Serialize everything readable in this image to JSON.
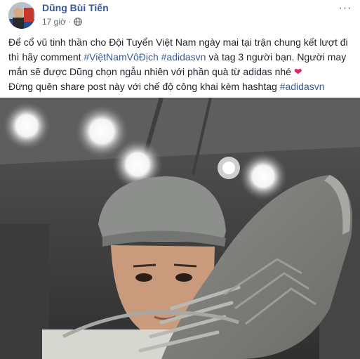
{
  "post": {
    "author": "Dũng Bùi Tiến",
    "timestamp": "17 giờ",
    "separator": "·",
    "privacy_icon": "globe-icon",
    "menu_icon": "more-horizontal-icon",
    "menu_label": "···",
    "text": {
      "line1_prefix": "Để cổ vũ tinh thần cho Đội Tuyển Việt Nam ngày mai tại trận chung kết lượt đi thì hãy comment ",
      "hashtag1": "#ViệtNamVôĐịch",
      "hashtag2": "#adidasvn",
      "line1_suffix": " và tag 3 người bạn. Người may mắn sẽ được Dũng chọn ngẫu nhiên với phần quà từ adidas nhé ",
      "heart": "❤",
      "line2_prefix": "Đừng quên share post này với chế độ công khai kèm hashtag ",
      "hashtag3": "#adidasvn"
    },
    "colors": {
      "author": "#385898",
      "hashtag": "#365899",
      "heart": "#e0245e",
      "meta": "#606770"
    }
  }
}
